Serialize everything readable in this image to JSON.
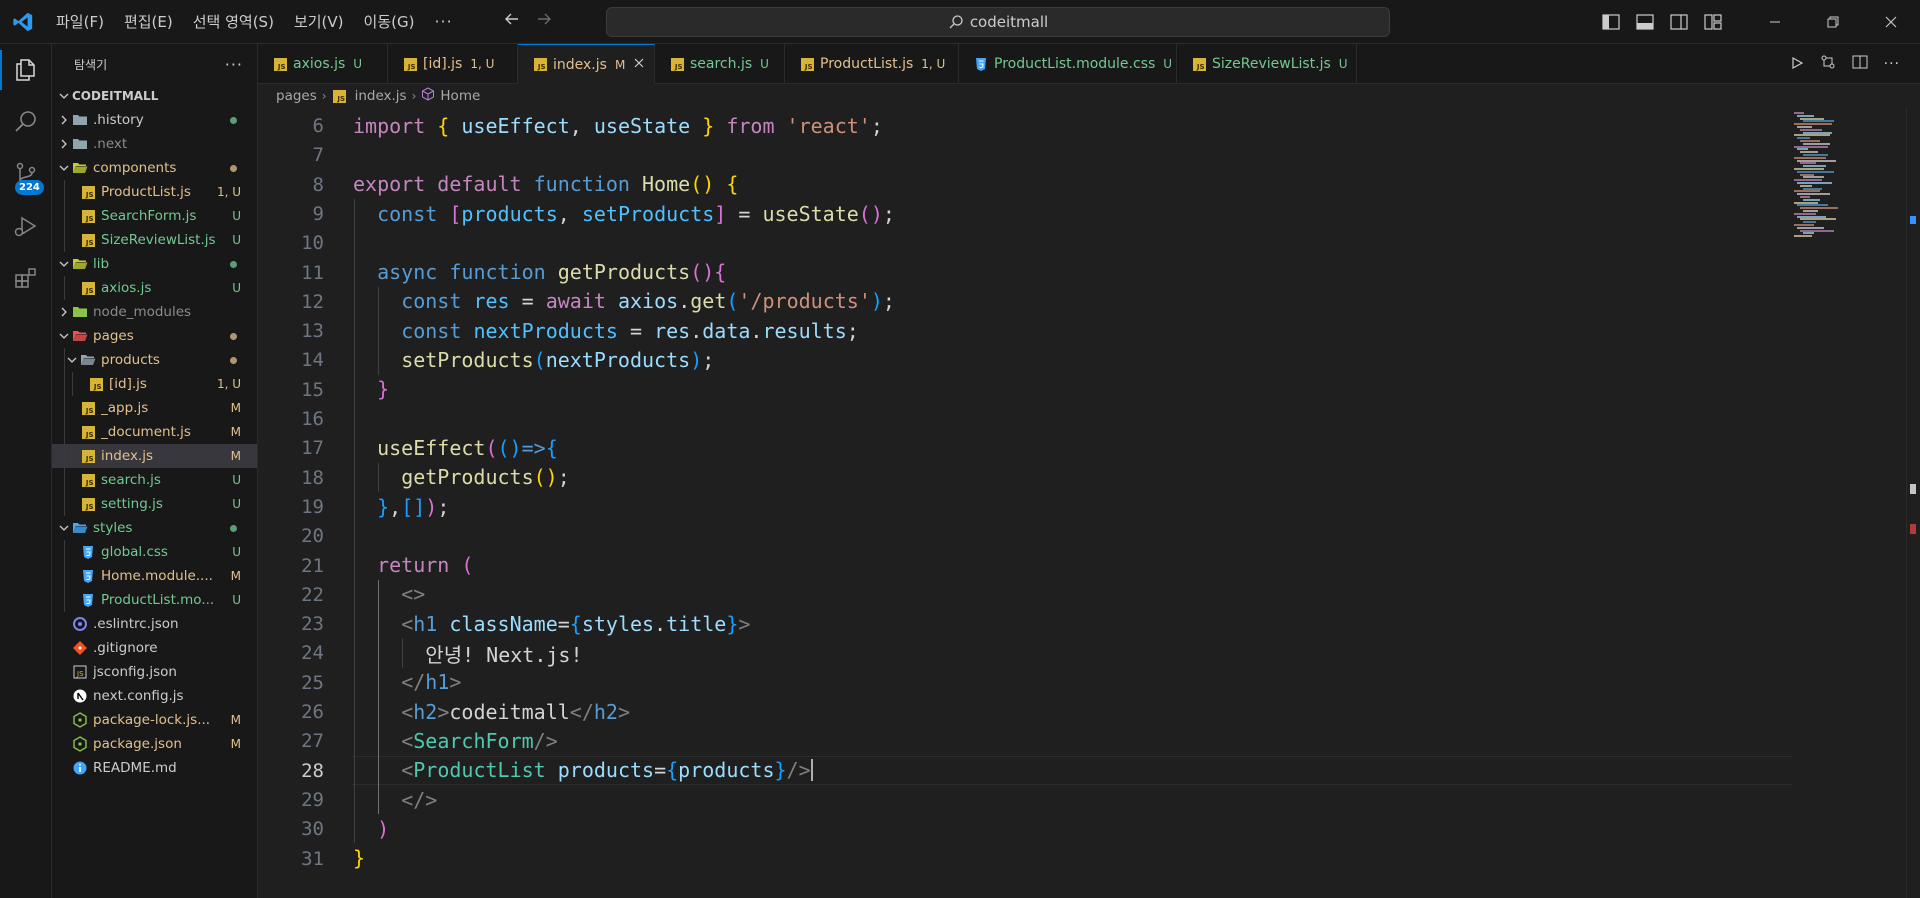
{
  "menu": [
    "파일(F)",
    "편집(E)",
    "선택 영역(S)",
    "보기(V)",
    "이동(G)"
  ],
  "command_center": "codeitmall",
  "activity": {
    "scm_badge": "224"
  },
  "sidebar": {
    "title": "탐색기",
    "section": "CODEITMALL",
    "items": [
      {
        "name": ".history",
        "kind": "folder",
        "depth": 0,
        "open": false,
        "status": "",
        "color": "white",
        "dot": "green"
      },
      {
        "name": ".next",
        "kind": "folder",
        "depth": 0,
        "open": false,
        "status": "",
        "color": "gray",
        "dot": ""
      },
      {
        "name": "components",
        "kind": "folder",
        "depth": 0,
        "open": true,
        "status": "",
        "color": "yellow",
        "dot": "yellow"
      },
      {
        "name": "ProductList.js",
        "kind": "js",
        "depth": 1,
        "status": "1, U",
        "color": "yellow",
        "dot": ""
      },
      {
        "name": "SearchForm.js",
        "kind": "js",
        "depth": 1,
        "status": "U",
        "color": "green",
        "dot": ""
      },
      {
        "name": "SizeReviewList.js",
        "kind": "js",
        "depth": 1,
        "status": "U",
        "color": "green",
        "dot": ""
      },
      {
        "name": "lib",
        "kind": "folder",
        "depth": 0,
        "open": true,
        "status": "",
        "color": "green",
        "dot": "green"
      },
      {
        "name": "axios.js",
        "kind": "js",
        "depth": 1,
        "status": "U",
        "color": "green",
        "dot": ""
      },
      {
        "name": "node_modules",
        "kind": "folder",
        "depth": 0,
        "open": false,
        "status": "",
        "color": "gray",
        "dot": ""
      },
      {
        "name": "pages",
        "kind": "folder",
        "depth": 0,
        "open": true,
        "status": "",
        "color": "yellow",
        "dot": "yellow"
      },
      {
        "name": "products",
        "kind": "folder",
        "depth": 1,
        "open": true,
        "status": "",
        "color": "yellow",
        "dot": "yellow"
      },
      {
        "name": "[id].js",
        "kind": "js",
        "depth": 2,
        "status": "1, U",
        "color": "yellow",
        "dot": ""
      },
      {
        "name": "_app.js",
        "kind": "js",
        "depth": 1,
        "status": "M",
        "color": "yellow",
        "dot": ""
      },
      {
        "name": "_document.js",
        "kind": "js",
        "depth": 1,
        "status": "M",
        "color": "yellow",
        "dot": ""
      },
      {
        "name": "index.js",
        "kind": "js",
        "depth": 1,
        "status": "M",
        "color": "yellow",
        "dot": "",
        "selected": true
      },
      {
        "name": "search.js",
        "kind": "js",
        "depth": 1,
        "status": "U",
        "color": "green",
        "dot": ""
      },
      {
        "name": "setting.js",
        "kind": "js",
        "depth": 1,
        "status": "U",
        "color": "green",
        "dot": ""
      },
      {
        "name": "styles",
        "kind": "folder",
        "depth": 0,
        "open": true,
        "status": "",
        "color": "green",
        "dot": "green"
      },
      {
        "name": "global.css",
        "kind": "css",
        "depth": 1,
        "status": "U",
        "color": "green",
        "dot": ""
      },
      {
        "name": "Home.module....",
        "kind": "css",
        "depth": 1,
        "status": "M",
        "color": "yellow",
        "dot": ""
      },
      {
        "name": "ProductList.mo...",
        "kind": "css",
        "depth": 1,
        "status": "U",
        "color": "green",
        "dot": ""
      },
      {
        "name": ".eslintrc.json",
        "kind": "eslint",
        "depth": 0,
        "status": "",
        "color": "white",
        "dot": ""
      },
      {
        "name": ".gitignore",
        "kind": "git",
        "depth": 0,
        "status": "",
        "color": "white",
        "dot": ""
      },
      {
        "name": "jsconfig.json",
        "kind": "jsconfig",
        "depth": 0,
        "status": "",
        "color": "white",
        "dot": ""
      },
      {
        "name": "next.config.js",
        "kind": "next",
        "depth": 0,
        "status": "",
        "color": "white",
        "dot": ""
      },
      {
        "name": "package-lock.js...",
        "kind": "npm",
        "depth": 0,
        "status": "M",
        "color": "yellow",
        "dot": ""
      },
      {
        "name": "package.json",
        "kind": "npm",
        "depth": 0,
        "status": "M",
        "color": "yellow",
        "dot": ""
      },
      {
        "name": "README.md",
        "kind": "info",
        "depth": 0,
        "status": "",
        "color": "white",
        "dot": ""
      }
    ]
  },
  "tabs": [
    {
      "name": "axios.js",
      "kind": "js",
      "status": "U",
      "color": "green",
      "active": false
    },
    {
      "name": "[id].js",
      "kind": "js",
      "status": "1, U",
      "color": "yellow",
      "active": false
    },
    {
      "name": "index.js",
      "kind": "js",
      "status": "M",
      "color": "yellow",
      "active": true
    },
    {
      "name": "search.js",
      "kind": "js",
      "status": "U",
      "color": "green",
      "active": false
    },
    {
      "name": "ProductList.js",
      "kind": "js",
      "status": "1, U",
      "color": "yellow",
      "active": false
    },
    {
      "name": "ProductList.module.css",
      "kind": "css",
      "status": "U",
      "color": "green",
      "active": false
    },
    {
      "name": "SizeReviewList.js",
      "kind": "js",
      "status": "U",
      "color": "green",
      "active": false
    }
  ],
  "breadcrumbs": [
    "pages",
    "index.js",
    "Home"
  ],
  "editor": {
    "current_line": 28,
    "lines": [
      {
        "n": 6,
        "i": 0,
        "t": [
          [
            "kw",
            "import"
          ],
          [
            "tx",
            " "
          ],
          [
            "b1",
            "{"
          ],
          [
            "tx",
            " "
          ],
          [
            "vr",
            "useEffect"
          ],
          [
            "tx",
            ", "
          ],
          [
            "vr",
            "useState"
          ],
          [
            "tx",
            " "
          ],
          [
            "b1",
            "}"
          ],
          [
            "tx",
            " "
          ],
          [
            "kw",
            "from"
          ],
          [
            "tx",
            " "
          ],
          [
            "st",
            "'react'"
          ],
          [
            "tx",
            ";"
          ]
        ]
      },
      {
        "n": 7,
        "i": 0,
        "t": []
      },
      {
        "n": 8,
        "i": 0,
        "t": [
          [
            "kw",
            "export"
          ],
          [
            "tx",
            " "
          ],
          [
            "kw",
            "default"
          ],
          [
            "tx",
            " "
          ],
          [
            "kb",
            "function"
          ],
          [
            "tx",
            " "
          ],
          [
            "fn",
            "Home"
          ],
          [
            "b1",
            "()"
          ],
          [
            "tx",
            " "
          ],
          [
            "b1",
            "{"
          ]
        ]
      },
      {
        "n": 9,
        "i": 1,
        "t": [
          [
            "kb",
            "const"
          ],
          [
            "tx",
            " "
          ],
          [
            "b2",
            "["
          ],
          [
            "cn",
            "products"
          ],
          [
            "tx",
            ", "
          ],
          [
            "cn",
            "setProducts"
          ],
          [
            "b2",
            "]"
          ],
          [
            "tx",
            " = "
          ],
          [
            "fn",
            "useState"
          ],
          [
            "b2",
            "()"
          ],
          [
            "tx",
            ";"
          ]
        ]
      },
      {
        "n": 10,
        "i": 1,
        "t": []
      },
      {
        "n": 11,
        "i": 1,
        "t": [
          [
            "kb",
            "async"
          ],
          [
            "tx",
            " "
          ],
          [
            "kb",
            "function"
          ],
          [
            "tx",
            " "
          ],
          [
            "fn",
            "getProducts"
          ],
          [
            "b2",
            "()"
          ],
          [
            "b2",
            "{"
          ]
        ]
      },
      {
        "n": 12,
        "i": 2,
        "t": [
          [
            "kb",
            "const"
          ],
          [
            "tx",
            " "
          ],
          [
            "cn",
            "res"
          ],
          [
            "tx",
            " = "
          ],
          [
            "kw",
            "await"
          ],
          [
            "tx",
            " "
          ],
          [
            "vr",
            "axios"
          ],
          [
            "tx",
            "."
          ],
          [
            "fn",
            "get"
          ],
          [
            "b3",
            "("
          ],
          [
            "st",
            "'/products'"
          ],
          [
            "b3",
            ")"
          ],
          [
            "tx",
            ";"
          ]
        ]
      },
      {
        "n": 13,
        "i": 2,
        "t": [
          [
            "kb",
            "const"
          ],
          [
            "tx",
            " "
          ],
          [
            "cn",
            "nextProducts"
          ],
          [
            "tx",
            " = "
          ],
          [
            "vr",
            "res"
          ],
          [
            "tx",
            "."
          ],
          [
            "vr",
            "data"
          ],
          [
            "tx",
            "."
          ],
          [
            "vr",
            "results"
          ],
          [
            "tx",
            ";"
          ]
        ]
      },
      {
        "n": 14,
        "i": 2,
        "t": [
          [
            "fn",
            "setProducts"
          ],
          [
            "b3",
            "("
          ],
          [
            "vr",
            "nextProducts"
          ],
          [
            "b3",
            ")"
          ],
          [
            "tx",
            ";"
          ]
        ]
      },
      {
        "n": 15,
        "i": 1,
        "t": [
          [
            "b2",
            "}"
          ]
        ]
      },
      {
        "n": 16,
        "i": 1,
        "t": []
      },
      {
        "n": 17,
        "i": 1,
        "t": [
          [
            "fn",
            "useEffect"
          ],
          [
            "b2",
            "("
          ],
          [
            "b3",
            "()"
          ],
          [
            "kb",
            "=>"
          ],
          [
            "b3",
            "{"
          ]
        ]
      },
      {
        "n": 18,
        "i": 2,
        "t": [
          [
            "fn",
            "getProducts"
          ],
          [
            "b1",
            "()"
          ],
          [
            "tx",
            ";"
          ]
        ]
      },
      {
        "n": 19,
        "i": 1,
        "t": [
          [
            "b3",
            "}"
          ],
          [
            "tx",
            ","
          ],
          [
            "b3",
            "[]"
          ],
          [
            "b2",
            ")"
          ],
          [
            "tx",
            ";"
          ]
        ]
      },
      {
        "n": 20,
        "i": 1,
        "t": []
      },
      {
        "n": 21,
        "i": 1,
        "t": [
          [
            "kw",
            "return"
          ],
          [
            "tx",
            " "
          ],
          [
            "b2",
            "("
          ]
        ]
      },
      {
        "n": 22,
        "i": 2,
        "t": [
          [
            "tg",
            "<>"
          ]
        ]
      },
      {
        "n": 23,
        "i": 2,
        "t": [
          [
            "tg",
            "<"
          ],
          [
            "kb",
            "h1"
          ],
          [
            "tx",
            " "
          ],
          [
            "vr",
            "className"
          ],
          [
            "tx",
            "="
          ],
          [
            "b3",
            "{"
          ],
          [
            "vr",
            "styles"
          ],
          [
            "tx",
            "."
          ],
          [
            "vr",
            "title"
          ],
          [
            "b3",
            "}"
          ],
          [
            "tg",
            ">"
          ]
        ]
      },
      {
        "n": 24,
        "i": 3,
        "t": [
          [
            "tx",
            "안녕! Next.js!"
          ]
        ]
      },
      {
        "n": 25,
        "i": 2,
        "t": [
          [
            "tg",
            "</"
          ],
          [
            "kb",
            "h1"
          ],
          [
            "tg",
            ">"
          ]
        ]
      },
      {
        "n": 26,
        "i": 2,
        "t": [
          [
            "tg",
            "<"
          ],
          [
            "kb",
            "h2"
          ],
          [
            "tg",
            ">"
          ],
          [
            "tx",
            "codeitmall"
          ],
          [
            "tg",
            "</"
          ],
          [
            "kb",
            "h2"
          ],
          [
            "tg",
            ">"
          ]
        ]
      },
      {
        "n": 27,
        "i": 2,
        "t": [
          [
            "tg",
            "<"
          ],
          [
            "ty",
            "SearchForm"
          ],
          [
            "tg",
            "/>"
          ]
        ]
      },
      {
        "n": 28,
        "i": 2,
        "t": [
          [
            "tg",
            "<"
          ],
          [
            "ty",
            "ProductList"
          ],
          [
            "tx",
            " "
          ],
          [
            "vr",
            "products"
          ],
          [
            "tx",
            "="
          ],
          [
            "b3",
            "{"
          ],
          [
            "vr",
            "products"
          ],
          [
            "b3",
            "}"
          ],
          [
            "tg",
            "/>"
          ]
        ]
      },
      {
        "n": 29,
        "i": 2,
        "t": [
          [
            "tg",
            "</>"
          ]
        ]
      },
      {
        "n": 30,
        "i": 1,
        "t": [
          [
            "b2",
            ")"
          ]
        ]
      },
      {
        "n": 31,
        "i": 0,
        "t": [
          [
            "b1",
            "}"
          ]
        ]
      }
    ]
  },
  "colors": {
    "accent": "#0078d4",
    "modified": "#e2c08d",
    "untracked": "#73c991"
  }
}
